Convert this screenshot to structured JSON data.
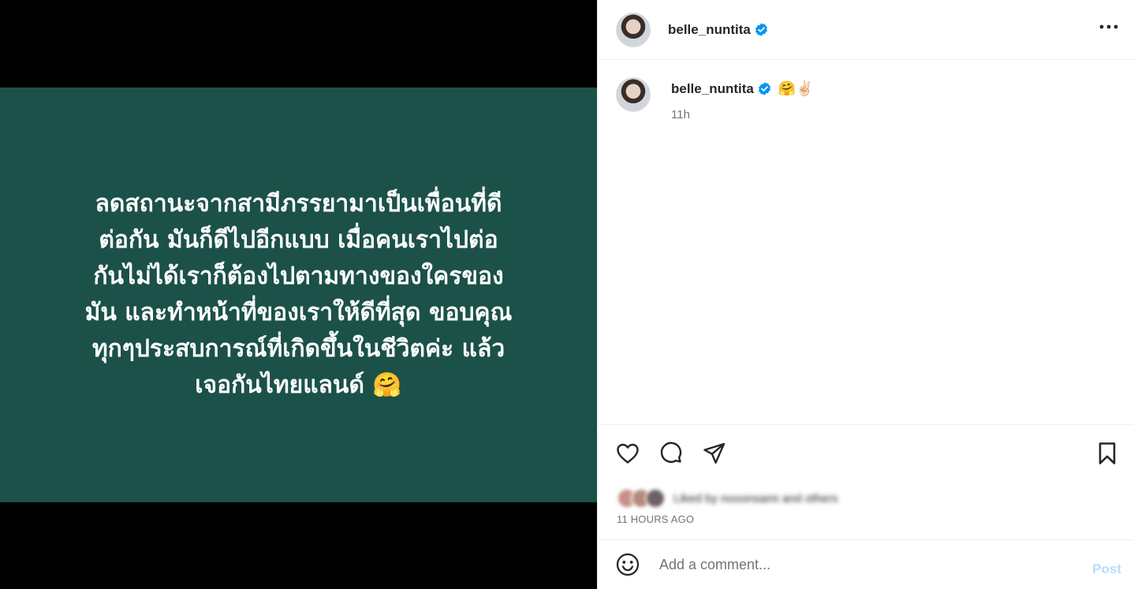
{
  "media": {
    "caption_lines": [
      "ลดสถานะจากสามีภรรยามาเป็นเพื่อนที่ดี",
      "ต่อกัน มันก็ดีไปอีกแบบ เมื่อคนเราไปต่อ",
      "กันไม่ได้เราก็ต้องไปตามทางของใครของ",
      "มัน และทำหน้าที่ของเราให้ดีที่สุด ขอบคุณ",
      "ทุกๆประสบการณ์ที่เกิดขึ้นในชีวิตค่ะ แล้ว",
      "เจอกันไทยแลนด์ 🤗"
    ],
    "background_color": "#1b5148"
  },
  "header": {
    "username": "belle_nuntita"
  },
  "caption": {
    "username": "belle_nuntita",
    "text": "🤗✌🏻",
    "time": "11h"
  },
  "likes": {
    "text": "Liked by nooonsami and others"
  },
  "post_time": "11 HOURS AGO",
  "comment": {
    "placeholder": "Add a comment...",
    "post_label": "Post"
  },
  "colors": {
    "verified": "#0095f6",
    "post_disabled": "#b8dcfb"
  }
}
